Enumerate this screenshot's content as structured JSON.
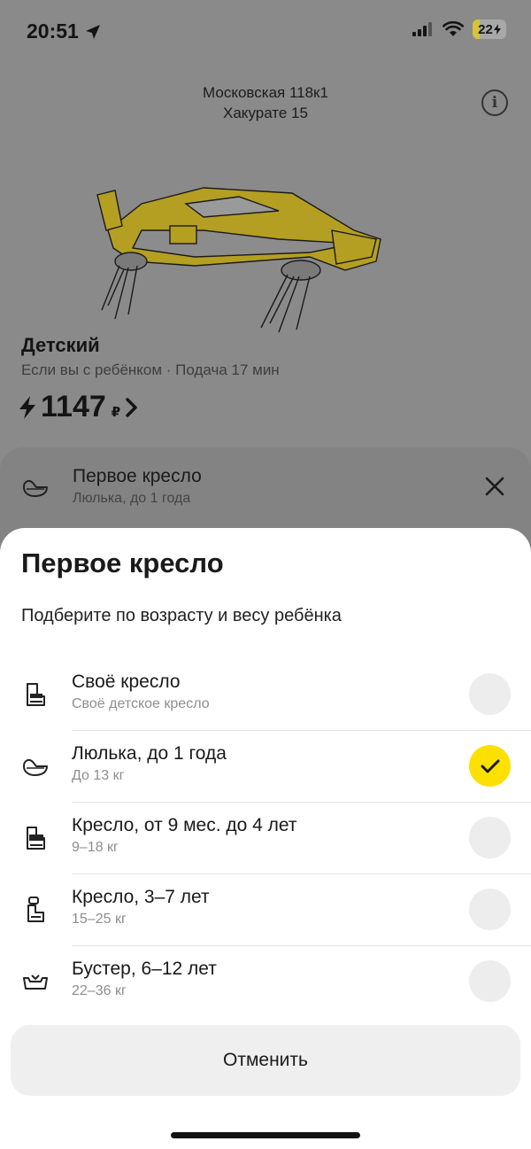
{
  "status_bar": {
    "time": "20:51",
    "battery": "22",
    "battery_level": 0.22,
    "icons": [
      "location-arrow-icon",
      "cellular-signal-icon",
      "wifi-icon",
      "battery-charging-icon"
    ]
  },
  "route": {
    "from": "Московская 118к1",
    "to": "Хакурате 15"
  },
  "tariff": {
    "name": "Детский",
    "subtitle": "Если вы с ребёнком · Подача 17 мин",
    "price": "1147",
    "currency": "₽"
  },
  "requirement": {
    "title": "Первое кресло",
    "subtitle": "Люлька, до 1 года"
  },
  "sheet": {
    "title": "Первое кресло",
    "subtitle": "Подберите по возрасту и весу ребёнка",
    "options": [
      {
        "title": "Своё кресло",
        "subtitle": "Своё детское кресло",
        "icon": "own-seat-icon",
        "selected": false
      },
      {
        "title": "Люлька, до 1 года",
        "subtitle": "До 13 кг",
        "icon": "infant-carrier-icon",
        "selected": true
      },
      {
        "title": "Кресло, от 9 мес. до 4 лет",
        "subtitle": "9–18 кг",
        "icon": "toddler-seat-icon",
        "selected": false
      },
      {
        "title": "Кресло, 3–7 лет",
        "subtitle": "15–25 кг",
        "icon": "child-seat-icon",
        "selected": false
      },
      {
        "title": "Бустер, 6–12 лет",
        "subtitle": "22–36 кг",
        "icon": "booster-seat-icon",
        "selected": false
      }
    ],
    "cancel_label": "Отменить"
  },
  "colors": {
    "accent": "#fce000",
    "overlay": "#8a8a8a"
  }
}
